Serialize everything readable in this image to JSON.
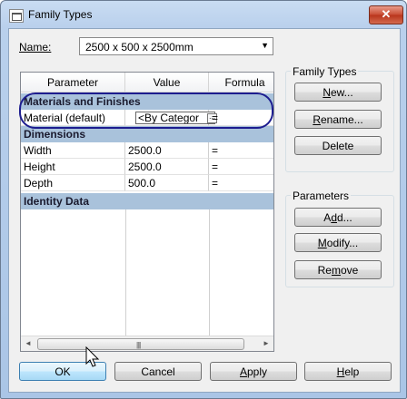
{
  "window": {
    "title": "Family Types",
    "close_symbol": "✕"
  },
  "name_field": {
    "label": "Name:",
    "value": "2500 x 500 x 2500mm",
    "arrow": "▼"
  },
  "table": {
    "headers": [
      "Parameter",
      "Value",
      "Formula"
    ],
    "groups": [
      {
        "title": "Materials and Finishes",
        "rows": [
          {
            "parameter": "Material (default)",
            "value": "<By Categor",
            "formula": "="
          }
        ]
      },
      {
        "title": "Dimensions",
        "rows": [
          {
            "parameter": "Width",
            "value": "2500.0",
            "formula": "="
          },
          {
            "parameter": "Height",
            "value": "2500.0",
            "formula": "="
          },
          {
            "parameter": "Depth",
            "value": "500.0",
            "formula": "="
          }
        ]
      },
      {
        "title": "Identity Data",
        "rows": []
      }
    ],
    "ellipsis": "...",
    "scroll_left": "◄",
    "scroll_right": "►",
    "grip": "||||"
  },
  "family_types_group": {
    "legend": "Family Types",
    "buttons": [
      {
        "pre": "",
        "ul": "N",
        "post": "ew..."
      },
      {
        "pre": "",
        "ul": "R",
        "post": "ename..."
      },
      {
        "pre": "",
        "ul": "",
        "post": "Delete"
      }
    ]
  },
  "parameters_group": {
    "legend": "Parameters",
    "buttons": [
      {
        "pre": "A",
        "ul": "d",
        "post": "d..."
      },
      {
        "pre": "",
        "ul": "M",
        "post": "odify..."
      },
      {
        "pre": "Re",
        "ul": "m",
        "post": "ove"
      }
    ]
  },
  "footer": {
    "ok": "OK",
    "cancel": "Cancel",
    "apply": {
      "pre": "",
      "ul": "A",
      "post": "pply"
    },
    "help": {
      "pre": "",
      "ul": "H",
      "post": "elp"
    }
  }
}
